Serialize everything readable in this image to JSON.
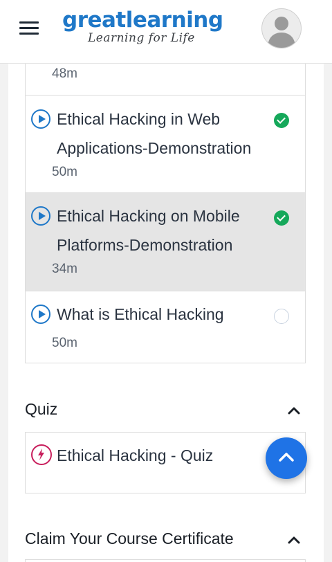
{
  "header": {
    "logo_main": "greatlearning",
    "logo_tagline": "Learning for Life",
    "menu_icon": "hamburger-menu-icon",
    "avatar_icon": "user-avatar-icon"
  },
  "lessons": {
    "partial_duration": "48m",
    "items": [
      {
        "title_line1": "Ethical Hacking in Web",
        "title_line2": "Applications-Demonstration",
        "duration": "50m",
        "completed": true
      },
      {
        "title_line1": "Ethical Hacking on Mobile",
        "title_line2": "Platforms-Demonstration",
        "duration": "34m",
        "completed": true
      },
      {
        "title_line1": "What is Ethical Hacking",
        "title_line2": "",
        "duration": "50m",
        "completed": false
      }
    ]
  },
  "quiz_section": {
    "title": "Quiz",
    "items": [
      {
        "title": "Ethical Hacking - Quiz"
      }
    ]
  },
  "certificate_section": {
    "title": "Claim Your Course Certificate"
  },
  "colors": {
    "brand_blue": "#1f78c8",
    "check_green": "#15a85a",
    "quiz_pink": "#c81e5c",
    "fab_blue": "#1f73e6",
    "active_row": "#e5e5e5"
  }
}
